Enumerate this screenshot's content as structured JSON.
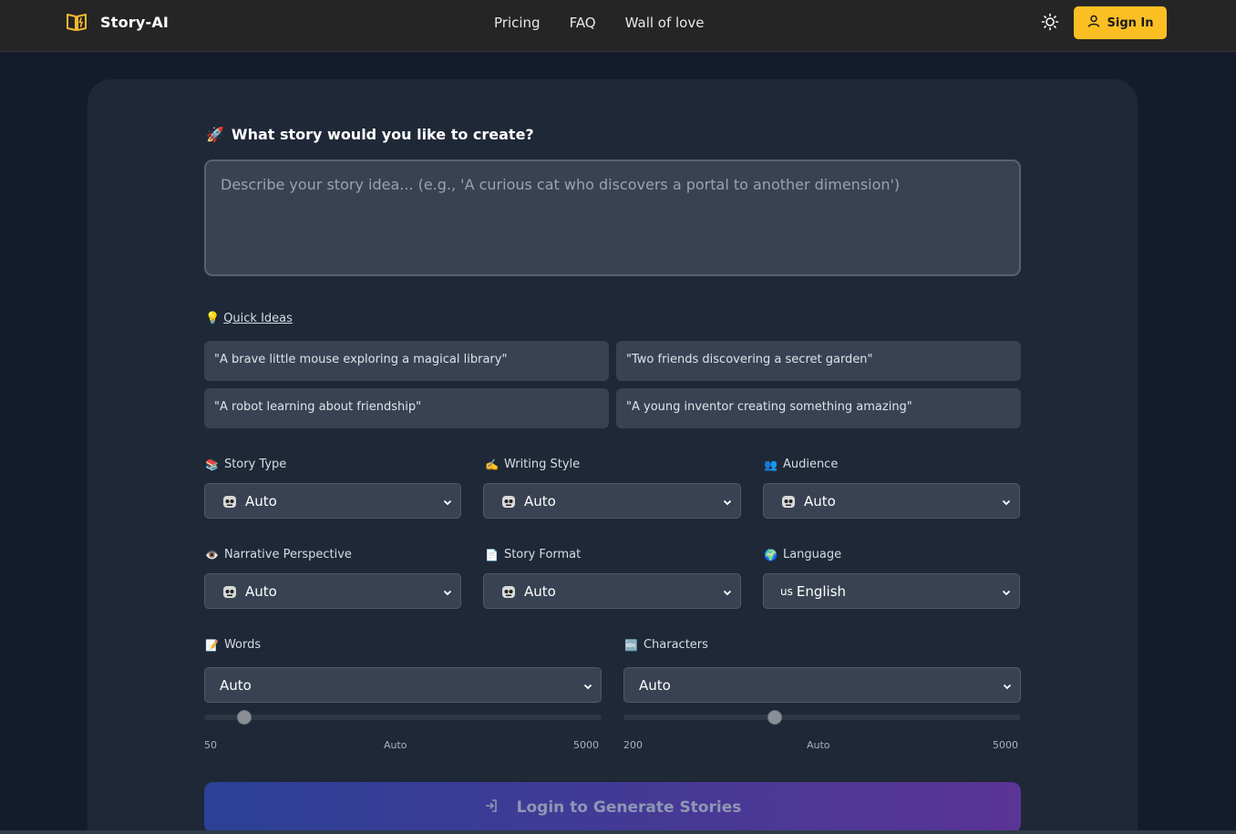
{
  "header": {
    "brand": "Story-AI",
    "nav": [
      "Pricing",
      "FAQ",
      "Wall of love"
    ],
    "sign_in": "Sign In",
    "icons": {
      "logo": "open-book-icon",
      "theme": "sun-icon",
      "user": "user-icon"
    },
    "accent": "#fbbf24"
  },
  "prompt": {
    "emoji": "🚀",
    "title": "What story would you like to create?",
    "placeholder": "Describe your story idea... (e.g., 'A curious cat who discovers a portal to another dimension')",
    "value": ""
  },
  "quick_ideas": {
    "emoji": "💡",
    "title": "Quick Ideas",
    "items": [
      "\"A brave little mouse exploring a magical library\"",
      "\"Two friends discovering a secret garden\"",
      "\"A robot learning about friendship\"",
      "\"A young inventor creating something amazing\""
    ]
  },
  "options": {
    "story_type": {
      "emoji": "📚",
      "label": "Story Type",
      "value": "Auto"
    },
    "writing_style": {
      "emoji": "✍️",
      "label": "Writing Style",
      "value": "Auto"
    },
    "audience": {
      "emoji": "👥",
      "label": "Audience",
      "value": "Auto"
    },
    "perspective": {
      "emoji": "👁️",
      "label": "Narrative Perspective",
      "value": "Auto"
    },
    "format": {
      "emoji": "📄",
      "label": "Story Format",
      "value": "Auto"
    },
    "language": {
      "emoji": "🌍",
      "label": "Language",
      "flag": "us",
      "value": "English"
    }
  },
  "words": {
    "emoji": "📝",
    "label": "Words",
    "value": "Auto",
    "min": "50",
    "mid": "Auto",
    "max": "5000",
    "position": 0.1
  },
  "characters": {
    "emoji": "🔤",
    "label": "Characters",
    "value": "Auto",
    "min": "200",
    "mid": "Auto",
    "max": "5000",
    "position": 0.38
  },
  "cta": {
    "label": "Login to Generate Stories",
    "icon": "login-arrow-icon"
  }
}
